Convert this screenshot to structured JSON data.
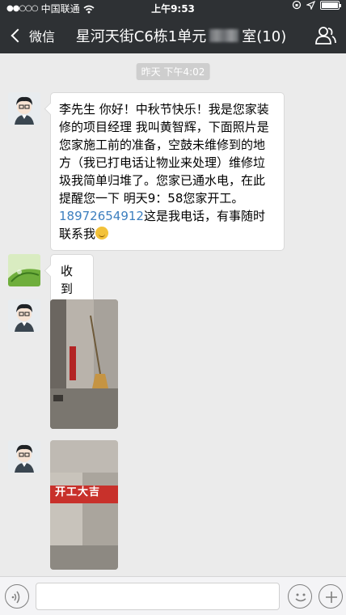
{
  "status_bar": {
    "signal_dots": "●●○○○",
    "carrier": "中国联通",
    "time": "上午9:53",
    "battery_icon": "battery-full-icon"
  },
  "nav": {
    "back_label": "微信",
    "title_prefix": "星河天街C6栋1单元",
    "title_suffix": "室(10)"
  },
  "chat": {
    "timestamp": "昨天 下午4:02",
    "messages": [
      {
        "type": "text",
        "text_before_phone": "李先生 你好！中秋节快乐！我是您家装修的项目经理 我叫黄智辉，下面照片是 您家施工前的准备，空鼓未维修到的地方（我已打电话让物业来处理）维修垃圾我简单归堆了。您家已通水电，在此提醒您一下 明天9：58您家开工。",
        "phone": "18972654912",
        "text_after_phone": "这是我电话，有事随时联系我"
      },
      {
        "type": "text",
        "text": "收到"
      },
      {
        "type": "image",
        "banner_text": ""
      },
      {
        "type": "image",
        "banner_text": "开工大吉"
      }
    ]
  },
  "colors": {
    "nav_bg": "#2e3134",
    "chat_bg": "#ebebeb",
    "link": "#3d7fbf",
    "banner_red": "#c8312b"
  }
}
